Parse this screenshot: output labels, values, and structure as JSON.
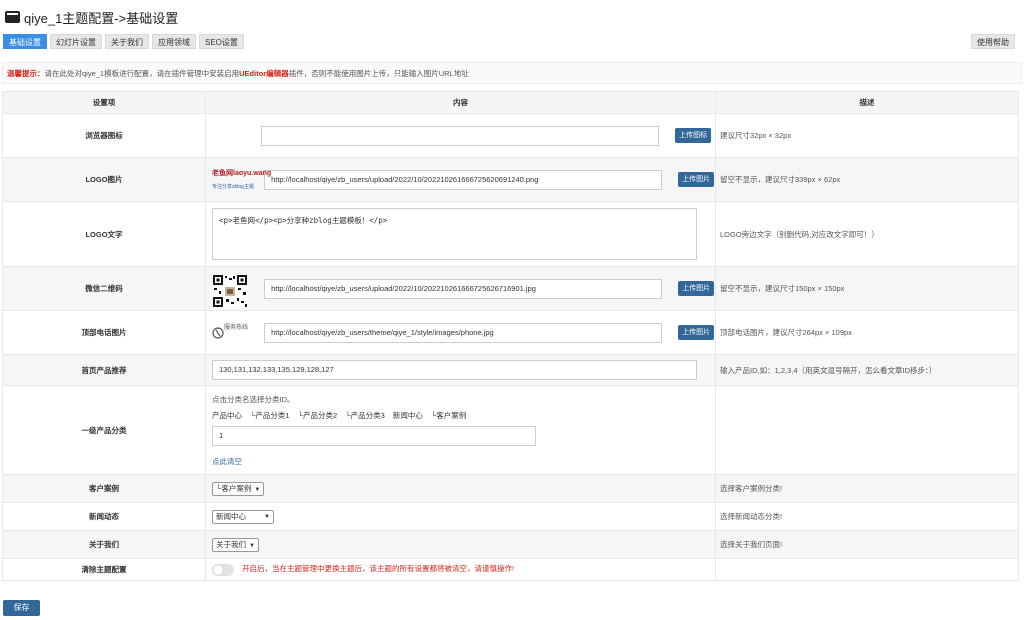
{
  "header": {
    "title": "qiye_1主题配置->基础设置",
    "help": "使用帮助"
  },
  "tabs": [
    "基础设置",
    "幻灯片设置",
    "关于我们",
    "应用领域",
    "SEO设置"
  ],
  "tip": {
    "label": "温馨提示：",
    "pre": "请在此处对qiye_1模板进行配置，请在插件管理中安装启用",
    "editor": "UEditor编辑器",
    "post": "插件，否则不能使用图片上传，只能输入图片URL地址"
  },
  "table": {
    "headers": [
      "设置项",
      "内容",
      "描述"
    ],
    "favicon": {
      "label": "浏览器图标",
      "value": "",
      "button": "上传图标",
      "desc": "建议尺寸32px × 32px"
    },
    "logo": {
      "label": "LOGO图片",
      "value": "http://localhost/qiye/zb_users/upload/2022/10/202210261666725620691240.png",
      "button": "上传图片",
      "desc": "留空不显示，建议尺寸339px × 62px",
      "thumb_text": "老鱼网laoyu.wang",
      "thumb_sub": "专注分享zblog主题"
    },
    "logo_text": {
      "label": "LOGO文字",
      "value": "<p>老鱼网</p><p>分享种zblog主题模板！</p>",
      "desc": "LOGO旁边文字（别删代码,对应改文字即可！）"
    },
    "wechat": {
      "label": "微信二维码",
      "value": "http://localhost/qiye/zb_users/upload/2022/10/202210261666725626716901.jpg",
      "button": "上传图片",
      "desc": "留空不显示，建议尺寸150px × 150px"
    },
    "phone": {
      "label": "顶部电话图片",
      "value": "http://localhost/qiye/zb_users/theme/qiye_1/style/images/phone.jpg",
      "button": "上传图片",
      "desc": "顶部电话图片，建议尺寸264px × 109px",
      "thumb_text": "服务热线"
    },
    "products": {
      "label": "首页产品推荐",
      "value": "130,131,132,133,135,129,128,127",
      "desc": "输入产品ID,如：1,2,3,4（用英文逗号隔开，怎么看文章ID移步：）"
    },
    "category": {
      "label": "一级产品分类",
      "hint": "点击分类名选择分类ID。",
      "items": [
        "产品中心",
        "└产品分类1",
        "└产品分类2",
        "└产品分类3",
        "新闻中心",
        "└客户案例"
      ],
      "value": "1",
      "clear": "点此清空"
    },
    "cases": {
      "label": "客户案例",
      "selected": "└客户案例",
      "desc": "选择客户案例分类!"
    },
    "news": {
      "label": "新闻动态",
      "selected": "新闻中心",
      "desc": "选择新闻动态分类!"
    },
    "about": {
      "label": "关于我们",
      "selected": "关于我们",
      "desc": "选择关于我们页面!"
    },
    "clear_config": {
      "label": "清除主题配置",
      "warning": "开启后，当在主题管理中更换主题后，该主题的所有设置都将被清空，请谨慎操作!"
    }
  },
  "save": "保存"
}
